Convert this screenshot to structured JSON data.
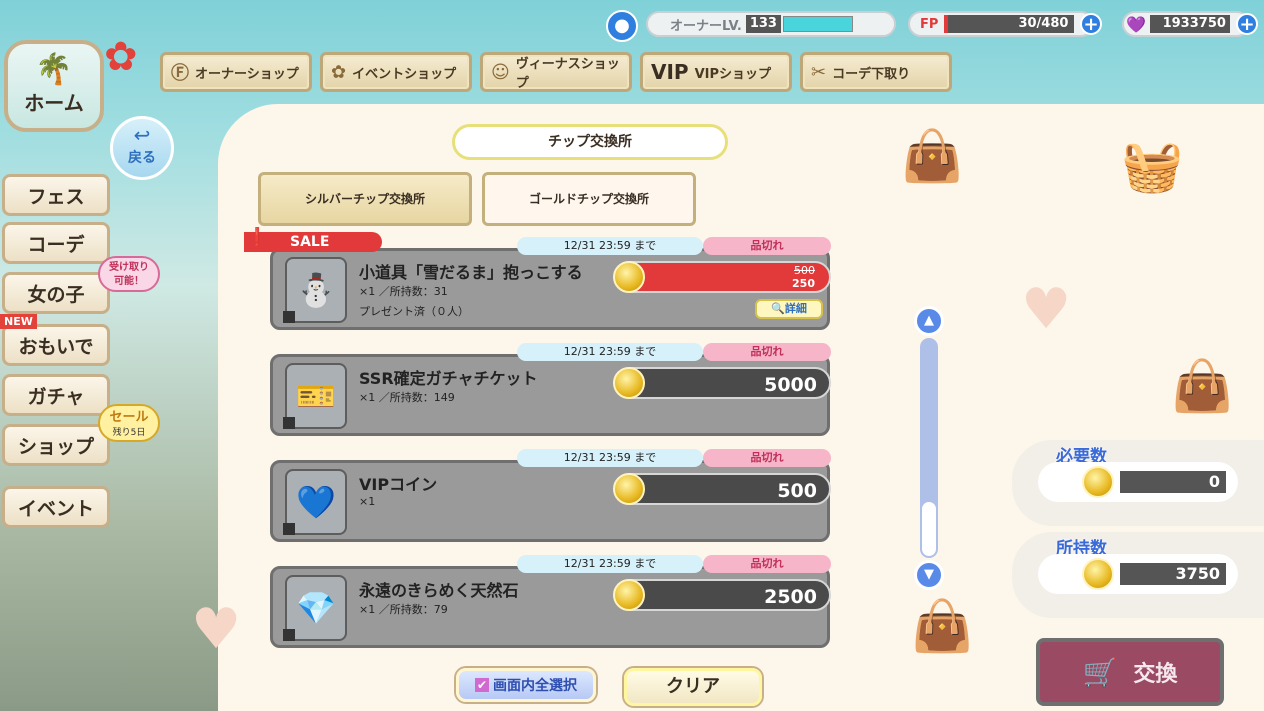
{
  "topbar": {
    "owner_lv_label": "オーナーLV.",
    "owner_lv": "133",
    "fp_label": "FP",
    "fp_value": "30/480",
    "gems": "1933750"
  },
  "shop_tabs": [
    {
      "label": "オーナーショップ",
      "icon": "fp-icon"
    },
    {
      "label": "イベントショップ",
      "icon": "event-icon"
    },
    {
      "label": "ヴィーナスショップ",
      "icon": "venus-icon"
    },
    {
      "label": "VIPショップ",
      "icon": "vip-icon",
      "prefix": "VIP"
    },
    {
      "label": "コーデ下取り",
      "icon": "tradein-icon"
    }
  ],
  "nav": {
    "home": "ホーム",
    "back": "戻る",
    "items": [
      "フェス",
      "コーデ",
      "女の子",
      "おもいで",
      "ガチャ",
      "ショップ",
      "イベント"
    ],
    "girls_badge": "受け取り\n可能！",
    "memories_badge": "NEW",
    "shop_badge_title": "セール",
    "shop_badge_sub": "残り5日"
  },
  "exchange": {
    "title": "チップ交換所",
    "tab_silver": "シルバーチップ交換所",
    "tab_gold": "ゴールドチップ交換所",
    "sale_label": "SALE"
  },
  "items": [
    {
      "name": "小道具「雪だるま」抱っこする",
      "qty": "×1 ／所持数：31",
      "extra": "プレゼント済（０人）",
      "date": "12/31 23:59 まで",
      "status": "品切れ",
      "old_price": "500",
      "price": "250",
      "detail": "詳細",
      "icon": "snowman-icon"
    },
    {
      "name": "SSR確定ガチャチケット",
      "qty": "×1 ／所持数：149",
      "date": "12/31 23:59 まで",
      "status": "品切れ",
      "price": "5000",
      "icon": "ticket-icon"
    },
    {
      "name": "VIPコイン",
      "qty": "×1",
      "date": "12/31 23:59 まで",
      "status": "品切れ",
      "price": "500",
      "icon": "vip-coin-icon"
    },
    {
      "name": "永遠のきらめく天然石",
      "qty": "×1 ／所持数：79",
      "date": "12/31 23:59 まで",
      "status": "品切れ",
      "price": "2500",
      "icon": "crystal-icon"
    }
  ],
  "right": {
    "required_label": "必要数",
    "required_value": "0",
    "owned_label": "所持数",
    "owned_value": "3750",
    "exchange_btn": "交換"
  },
  "bottom": {
    "select_all": "画面内全選択",
    "clear": "クリア"
  },
  "colors": {
    "accent_blue": "#3a6ad8",
    "sale_red": "#e23a3a",
    "sold_pink": "#f7b5c9"
  }
}
